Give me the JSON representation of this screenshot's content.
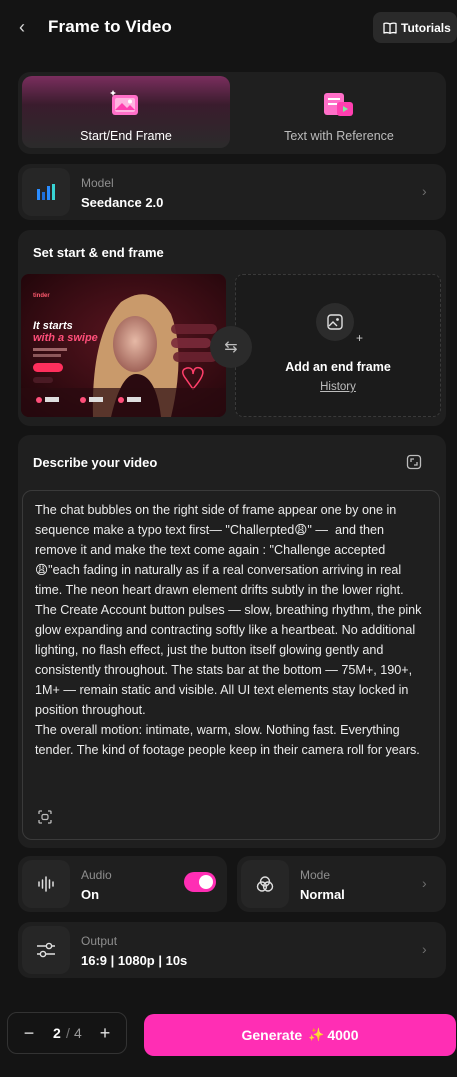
{
  "header": {
    "title": "Frame to Video",
    "tutorials_label": "Tutorials"
  },
  "mode_tabs": [
    {
      "label": "Start/End Frame",
      "active": true
    },
    {
      "label": "Text with Reference",
      "active": false
    }
  ],
  "model": {
    "label": "Model",
    "value": "Seedance 2.0"
  },
  "frames": {
    "title": "Set start & end frame",
    "start_frame_image": {
      "brand": "tinder",
      "headline_1": "It starts",
      "headline_2": "with a swipe"
    },
    "end_frame_label": "Add an end frame",
    "history_label": "History"
  },
  "prompt": {
    "title": "Describe your video",
    "text": "The chat bubbles on the right side of frame appear one by one in sequence make a typo text first— \"Challerpted😩\" —  and then remove it and make the text come again : \"Challenge accepted 😩\"each fading in naturally as if a real conversation arriving in real time. The neon heart drawn element drifts subtly in the lower right. The Create Account button pulses — slow, breathing rhythm, the pink glow expanding and contracting softly like a heartbeat. No additional lighting, no flash effect, just the button itself glowing gently and consistently throughout. The stats bar at the bottom — 75M+, 190+, 1M+ — remain static and visible. All UI text elements stay locked in position throughout.\nThe overall motion: intimate, warm, slow. Nothing fast. Everything tender. The kind of footage people keep in their camera roll for years."
  },
  "audio": {
    "label": "Audio",
    "value": "On",
    "enabled": true
  },
  "mode": {
    "label": "Mode",
    "value": "Normal"
  },
  "output": {
    "label": "Output",
    "value": "16:9 | 1080p | 10s"
  },
  "footer": {
    "count_value": "2",
    "count_separator": "/",
    "count_total": "4",
    "minus_label": "−",
    "plus_label": "+",
    "generate_label": "Generate",
    "generate_cost": "4000"
  },
  "colors": {
    "background": "#141414",
    "card": "#1f1f1f",
    "accent": "#ff2eb4"
  }
}
